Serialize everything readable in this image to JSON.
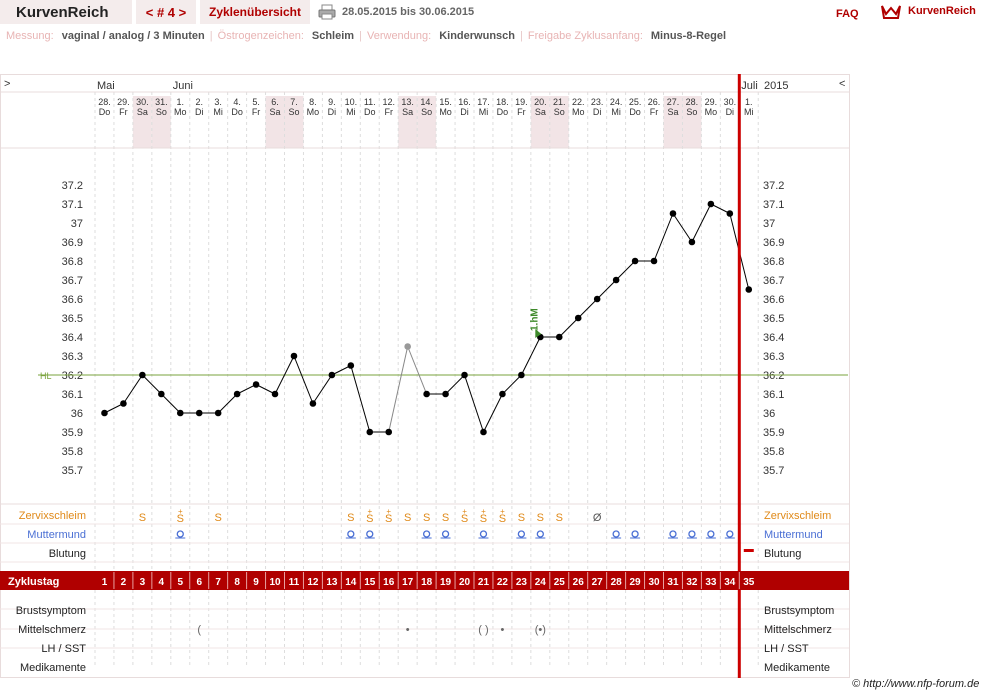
{
  "header": {
    "app_title": "KurvenReich",
    "cycle_label": "< # 4 >",
    "overview_label": "Zyklenübersicht",
    "date_range": "28.05.2015 bis 30.06.2015",
    "faq_label": "FAQ",
    "logo_text": "KurvenReich"
  },
  "info": {
    "messung_label": "Messung:",
    "messung_value": "vaginal / analog / 3 Minuten",
    "oestrogen_label": "Östrogenzeichen:",
    "oestrogen_value": "Schleim",
    "verwendung_label": "Verwendung:",
    "verwendung_value": "Kinderwunsch",
    "freigabe_label": "Freigabe Zyklusanfang:",
    "freigabe_value": "Minus-8-Regel"
  },
  "credit": "© http://www.nfp-forum.de",
  "chart_data": {
    "type": "line",
    "nav_left": ">",
    "nav_right": "<",
    "year": "2015",
    "months": [
      {
        "label": "Mai",
        "at_day": 28
      },
      {
        "label": "Juni",
        "at_day": 1
      },
      {
        "label": "Juli",
        "at_day": 1
      }
    ],
    "dates": [
      "28.",
      "29.",
      "30.",
      "31.",
      "1.",
      "2.",
      "3.",
      "4.",
      "5.",
      "6.",
      "7.",
      "8.",
      "9.",
      "10.",
      "11.",
      "12.",
      "13.",
      "14.",
      "15.",
      "16.",
      "17.",
      "18.",
      "19.",
      "20.",
      "21.",
      "22.",
      "23.",
      "24.",
      "25.",
      "26.",
      "27.",
      "28.",
      "29.",
      "30.",
      "1."
    ],
    "weekdays": [
      "Do",
      "Fr",
      "Sa",
      "So",
      "Mo",
      "Di",
      "Mi",
      "Do",
      "Fr",
      "Sa",
      "So",
      "Mo",
      "Di",
      "Mi",
      "Do",
      "Fr",
      "Sa",
      "So",
      "Mo",
      "Di",
      "Mi",
      "Do",
      "Fr",
      "Sa",
      "So",
      "Mo",
      "Di",
      "Mi",
      "Do",
      "Fr",
      "Sa",
      "So",
      "Mo",
      "Di",
      "Mi"
    ],
    "weekend_days": [
      3,
      4,
      10,
      11,
      17,
      18,
      24,
      25,
      31,
      32
    ],
    "cycle_days": [
      "1",
      "2",
      "3",
      "4",
      "5",
      "6",
      "7",
      "8",
      "9",
      "10",
      "11",
      "12",
      "13",
      "14",
      "15",
      "16",
      "17",
      "18",
      "19",
      "20",
      "21",
      "22",
      "23",
      "24",
      "25",
      "26",
      "27",
      "28",
      "29",
      "30",
      "31",
      "32",
      "33",
      "34",
      "35"
    ],
    "temperatures": [
      36.0,
      36.05,
      36.2,
      36.1,
      36.0,
      36.0,
      36.0,
      36.1,
      36.15,
      36.1,
      36.3,
      36.05,
      36.2,
      36.25,
      35.9,
      35.9,
      36.35,
      36.1,
      36.1,
      36.2,
      35.9,
      36.1,
      36.2,
      36.4,
      36.4,
      36.5,
      36.6,
      36.7,
      36.8,
      36.8,
      37.05,
      36.9,
      37.1,
      37.05,
      36.65
    ],
    "excluded_days": [
      17
    ],
    "ylim": [
      35.6,
      37.25
    ],
    "ticks": [
      "35.7",
      "35.8",
      "35.9",
      "36",
      "36.1",
      "36.2",
      "36.3",
      "36.4",
      "36.5",
      "36.6",
      "36.7",
      "36.8",
      "36.9",
      "37",
      "37.1",
      "37.2"
    ],
    "coverline": {
      "label": "HL",
      "value": 36.2
    },
    "annotation": {
      "label": "1.hM",
      "day": 24
    },
    "cycle_end_day": 35,
    "row_labels": {
      "zervix": "Zervixschleim",
      "mutter": "Muttermund",
      "blutung": "Blutung",
      "zyklustag": "Zyklustag",
      "brust": "Brustsymptom",
      "mittel": "Mittelschmerz",
      "lh": "LH / SST",
      "medi": "Medikamente"
    },
    "zervix": {
      "3": "S",
      "5": "S+",
      "7": "S",
      "14": "S",
      "15": "S+",
      "16": "S+",
      "17": "S",
      "18": "S",
      "19": "S",
      "20": "S+",
      "21": "S+",
      "22": "S+",
      "23": "S",
      "24": "S",
      "25": "S",
      "27": "Ø"
    },
    "muttermund": [
      5,
      14,
      15,
      18,
      19,
      21,
      23,
      24,
      28,
      29,
      31,
      32,
      33,
      34
    ],
    "blutung_days": [
      35
    ],
    "mittelschmerz": {
      "6": "(",
      "17": "•",
      "21": "( )",
      "22": "•",
      "24": "(•)"
    },
    "colors": {
      "accent": "#b00000",
      "line": "#000000",
      "coverline": "#7aa33c",
      "annotation": "#3e8a2a",
      "zervix": "#e08a1a",
      "muttermund": "#4a6fd4",
      "weekend": "#f2e4e6"
    }
  }
}
